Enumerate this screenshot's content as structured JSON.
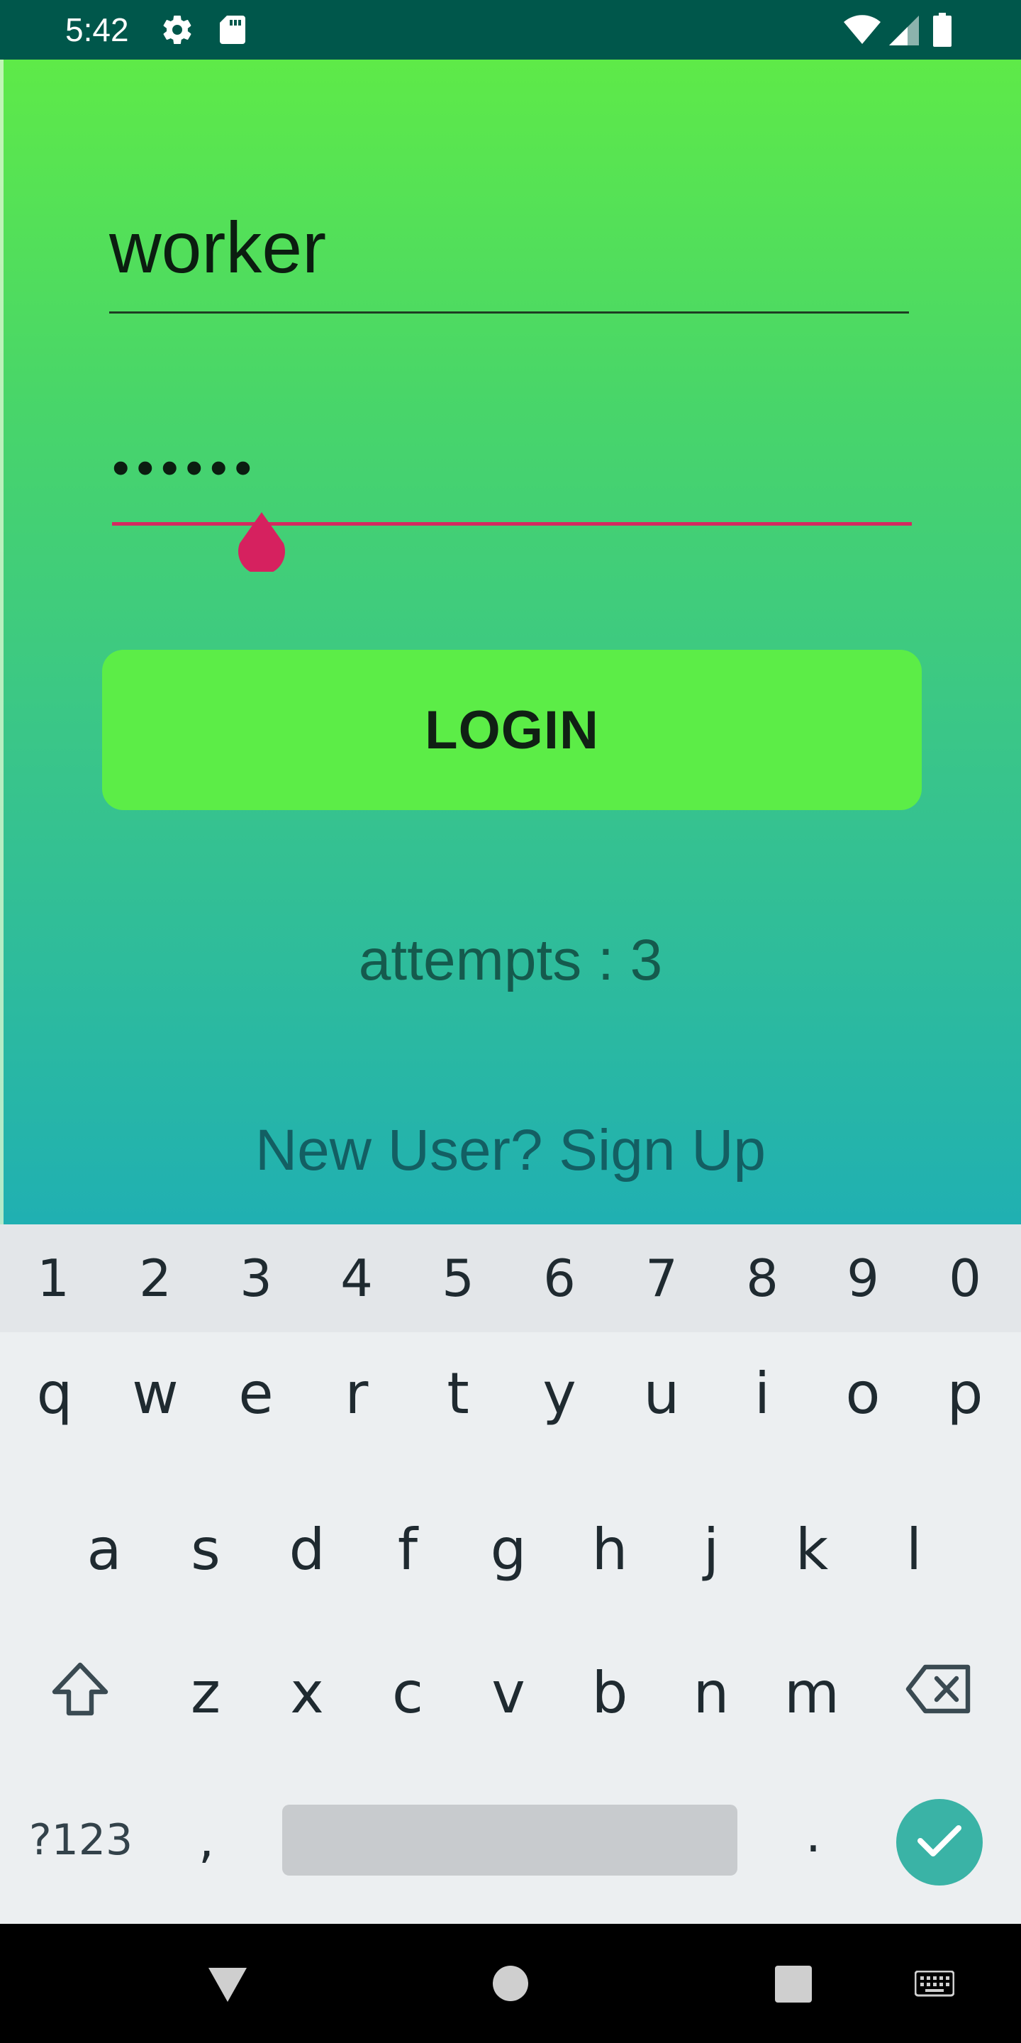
{
  "status_bar": {
    "time": "5:42",
    "icons": [
      "settings-icon",
      "sd-card-icon",
      "wifi-icon",
      "signal-icon",
      "battery-icon"
    ],
    "background": "#00574b"
  },
  "login": {
    "username_value": "worker",
    "password_value": "••••••",
    "login_label": "LOGIN",
    "attempts_text": "attempts : 3",
    "signup_text": "New User? Sign Up",
    "accent_color": "#d6295f",
    "button_color": "#5ced47"
  },
  "keyboard": {
    "number_row": [
      "1",
      "2",
      "3",
      "4",
      "5",
      "6",
      "7",
      "8",
      "9",
      "0"
    ],
    "row1": [
      "q",
      "w",
      "e",
      "r",
      "t",
      "y",
      "u",
      "i",
      "o",
      "p"
    ],
    "row2": [
      "a",
      "s",
      "d",
      "f",
      "g",
      "h",
      "j",
      "k",
      "l"
    ],
    "row3": [
      "z",
      "x",
      "c",
      "v",
      "b",
      "n",
      "m"
    ],
    "symbols_label": "?123",
    "comma": ",",
    "period": ".",
    "icons": [
      "shift-icon",
      "backspace-icon",
      "check-icon"
    ]
  },
  "nav_bar": {
    "icons": [
      "back-icon",
      "home-icon",
      "recents-icon",
      "keyboard-icon"
    ]
  }
}
